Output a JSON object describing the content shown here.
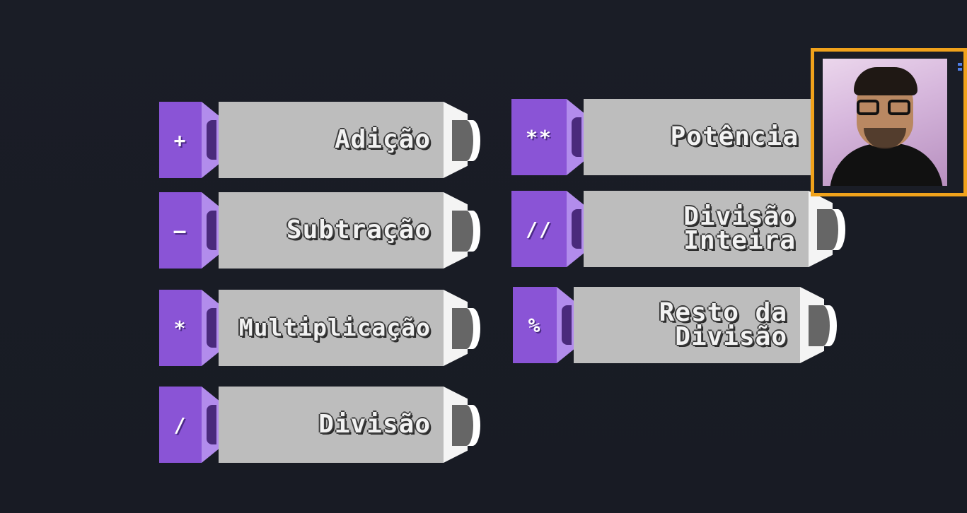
{
  "operators": [
    {
      "id": "addition",
      "symbol": "+",
      "label": "Adição"
    },
    {
      "id": "subtraction",
      "symbol": "–",
      "label": "Subtração"
    },
    {
      "id": "multiplication",
      "symbol": "*",
      "label": "Multiplicação"
    },
    {
      "id": "division",
      "symbol": "/",
      "label": "Divisão"
    },
    {
      "id": "power",
      "symbol": "**",
      "label": "Potência"
    },
    {
      "id": "integer-division",
      "symbol": "//",
      "label": "Divisão\nInteira"
    },
    {
      "id": "modulo",
      "symbol": "%",
      "label": "Resto da\nDivisão"
    }
  ],
  "colors": {
    "background": "#181b24",
    "key_purple": "#8a54d6",
    "key_purple_light": "#b28cec",
    "body_gray": "#bdbdbd",
    "cap_white": "#f4f4f4",
    "knob_gray": "#666666",
    "webcam_border": "#f0a21b"
  }
}
